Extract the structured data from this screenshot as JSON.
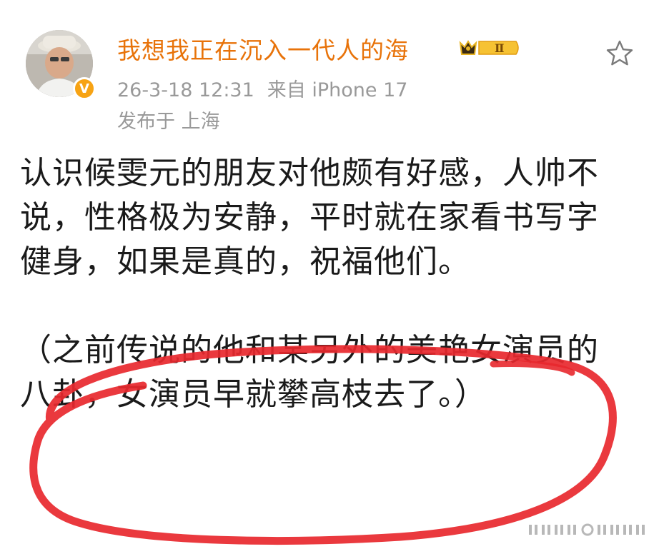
{
  "post": {
    "username": "我想我正在沉入一代人的海",
    "vip_level": "Ⅱ",
    "timestamp": "26-3-18 12:31",
    "source": "来自 iPhone 17",
    "location": "发布于 上海",
    "paragraphs": [
      "认识候雯元的朋友对他颇有好感，人帅不说，性格极为安静，平时就在家看书写字健身，如果是真的，祝福他们。",
      "（之前传说的他和某另外的美艳女演员的八卦，女演员早就攀高枝去了。）"
    ]
  },
  "colors": {
    "username": "#e8730a",
    "meta": "#999999",
    "text": "#1a1a1a",
    "annotation": "#e8282e",
    "verify_badge": "#f7a314"
  },
  "icons": {
    "favorite": "star-outline-icon",
    "verified": "verified-v-icon",
    "vip": "crown-icon"
  }
}
